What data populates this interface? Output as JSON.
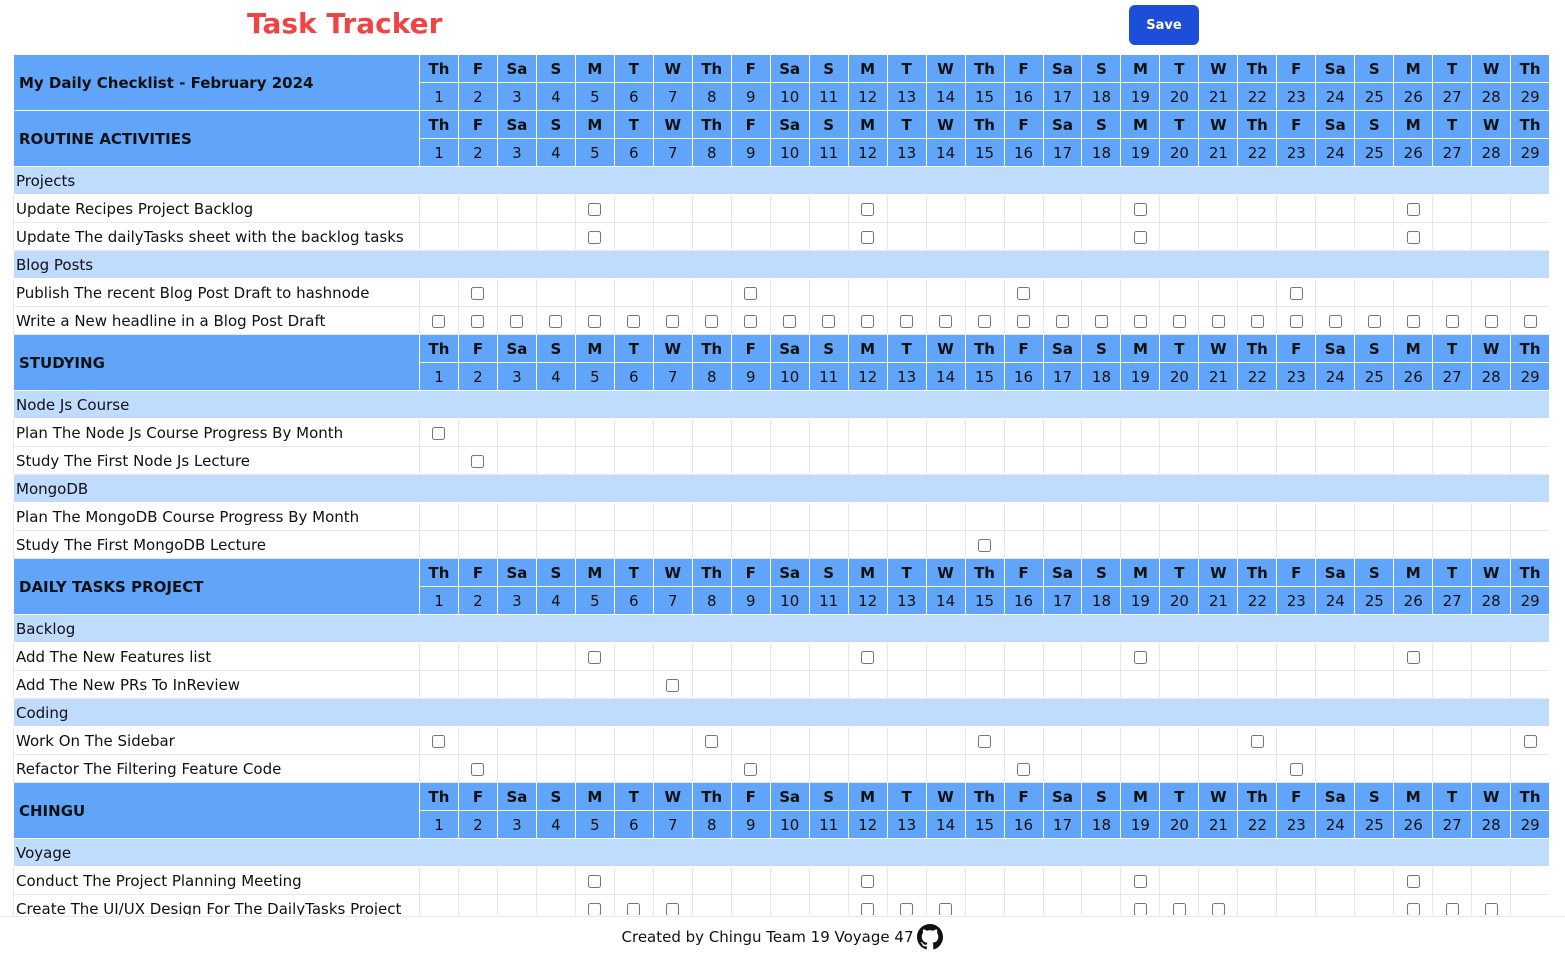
{
  "app": {
    "title": "Task Tracker",
    "save_label": "Save"
  },
  "calendar": {
    "day_names": [
      "Th",
      "F",
      "Sa",
      "S",
      "M",
      "T",
      "W",
      "Th",
      "F",
      "Sa",
      "S",
      "M",
      "T",
      "W",
      "Th",
      "F",
      "Sa",
      "S",
      "M",
      "T",
      "W",
      "Th",
      "F",
      "Sa",
      "S",
      "M",
      "T",
      "W",
      "Th"
    ],
    "dates": [
      "1",
      "2",
      "3",
      "4",
      "5",
      "6",
      "7",
      "8",
      "9",
      "10",
      "11",
      "12",
      "13",
      "14",
      "15",
      "16",
      "17",
      "18",
      "19",
      "20",
      "21",
      "22",
      "23",
      "24",
      "25",
      "26",
      "27",
      "28",
      "29"
    ]
  },
  "sections": [
    {
      "title": "My Daily Checklist - February 2024",
      "groups": []
    },
    {
      "title": "ROUTINE ACTIVITIES",
      "groups": [
        {
          "name": "Projects",
          "tasks": [
            {
              "label": "Update Recipes Project Backlog",
              "checkbox_days": [
                5,
                12,
                19,
                26
              ]
            },
            {
              "label": "Update The dailyTasks sheet with the backlog tasks",
              "checkbox_days": [
                5,
                12,
                19,
                26
              ]
            }
          ]
        },
        {
          "name": "Blog Posts",
          "tasks": [
            {
              "label": "Publish The recent Blog Post Draft to hashnode",
              "checkbox_days": [
                2,
                9,
                16,
                23
              ]
            },
            {
              "label": "Write a New headline in a Blog Post Draft",
              "checkbox_days": [
                1,
                2,
                3,
                4,
                5,
                6,
                7,
                8,
                9,
                10,
                11,
                12,
                13,
                14,
                15,
                16,
                17,
                18,
                19,
                20,
                21,
                22,
                23,
                24,
                25,
                26,
                27,
                28,
                29
              ]
            }
          ]
        }
      ]
    },
    {
      "title": "STUDYING",
      "groups": [
        {
          "name": "Node Js Course",
          "tasks": [
            {
              "label": "Plan The Node Js Course Progress By Month",
              "checkbox_days": [
                1
              ]
            },
            {
              "label": "Study The First Node Js Lecture",
              "checkbox_days": [
                2
              ]
            }
          ]
        },
        {
          "name": "MongoDB",
          "tasks": [
            {
              "label": "Plan The MongoDB Course Progress By Month",
              "checkbox_days": []
            },
            {
              "label": "Study The First MongoDB Lecture",
              "checkbox_days": [
                15
              ]
            }
          ]
        }
      ]
    },
    {
      "title": "DAILY TASKS PROJECT",
      "groups": [
        {
          "name": "Backlog",
          "tasks": [
            {
              "label": "Add The New Features list",
              "checkbox_days": [
                5,
                12,
                19,
                26
              ]
            },
            {
              "label": "Add The New PRs To InReview",
              "checkbox_days": [
                7
              ]
            }
          ]
        },
        {
          "name": "Coding",
          "tasks": [
            {
              "label": "Work On The Sidebar",
              "checkbox_days": [
                1,
                8,
                15,
                22,
                29
              ]
            },
            {
              "label": "Refactor The Filtering Feature Code",
              "checkbox_days": [
                2,
                9,
                16,
                23
              ]
            }
          ]
        }
      ]
    },
    {
      "title": "CHINGU",
      "groups": [
        {
          "name": "Voyage",
          "tasks": [
            {
              "label": "Conduct The Project Planning Meeting",
              "checkbox_days": [
                5,
                12,
                19,
                26
              ]
            },
            {
              "label": "Create The UI/UX Design For The DailyTasks Project",
              "checkbox_days": [
                5,
                6,
                7,
                12,
                13,
                14,
                19,
                20,
                21,
                26,
                27,
                28
              ]
            }
          ]
        }
      ]
    }
  ],
  "footer": {
    "text": "Created by Chingu Team 19 Voyage 47",
    "icon": "github-icon"
  },
  "colors": {
    "title": "#ef4444",
    "save_button": "#1d4ed8",
    "section_header": "#60a5fa",
    "category_row": "#bfdbfe",
    "grid_border": "#e5e7eb"
  }
}
